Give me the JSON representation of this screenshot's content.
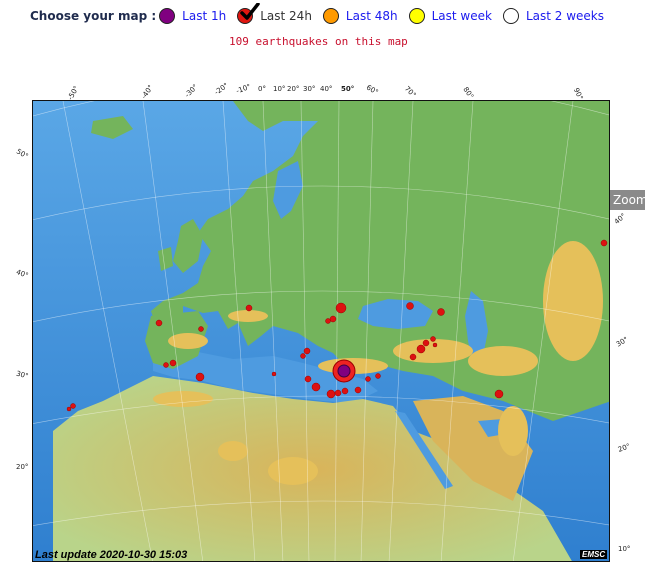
{
  "header": {
    "choose_label": "Choose your map :",
    "options": [
      {
        "label": "Last 1h",
        "color": "#800080",
        "icon": "purple-circle-icon"
      },
      {
        "label": "Last 24h",
        "color": "#e0150f",
        "icon": "red-circle-checked-icon",
        "selected": true
      },
      {
        "label": "Last 48h",
        "color": "#ff9a00",
        "icon": "orange-circle-icon"
      },
      {
        "label": "Last week",
        "color": "#ffff00",
        "icon": "yellow-circle-icon"
      },
      {
        "label": "Last 2 weeks",
        "color": "#ffffff",
        "icon": "white-circle-icon"
      }
    ]
  },
  "summary": {
    "count_text": "109 earthquakes on this map"
  },
  "map": {
    "zoom_label": "Zoom",
    "last_update": "Last update 2020-10-30 15:03",
    "credit": "EMSC",
    "top_degrees": [
      "-50°",
      "-40°",
      "-30°",
      "-20°",
      "-10°",
      "0°",
      "10°",
      "20°",
      "30°",
      "40°",
      "50°",
      "60°",
      "70°",
      "80°",
      "90°"
    ],
    "left_degrees": [
      "50°",
      "40°",
      "30°",
      "20°"
    ],
    "right_degrees": [
      "40°",
      "30°",
      "20°",
      "10°"
    ],
    "colors": {
      "ocean": "#3a8fd6",
      "land": "#6fb35a",
      "highland": "#e8c35a",
      "quake": "#dd1111",
      "latest_quake": "#800080"
    }
  }
}
